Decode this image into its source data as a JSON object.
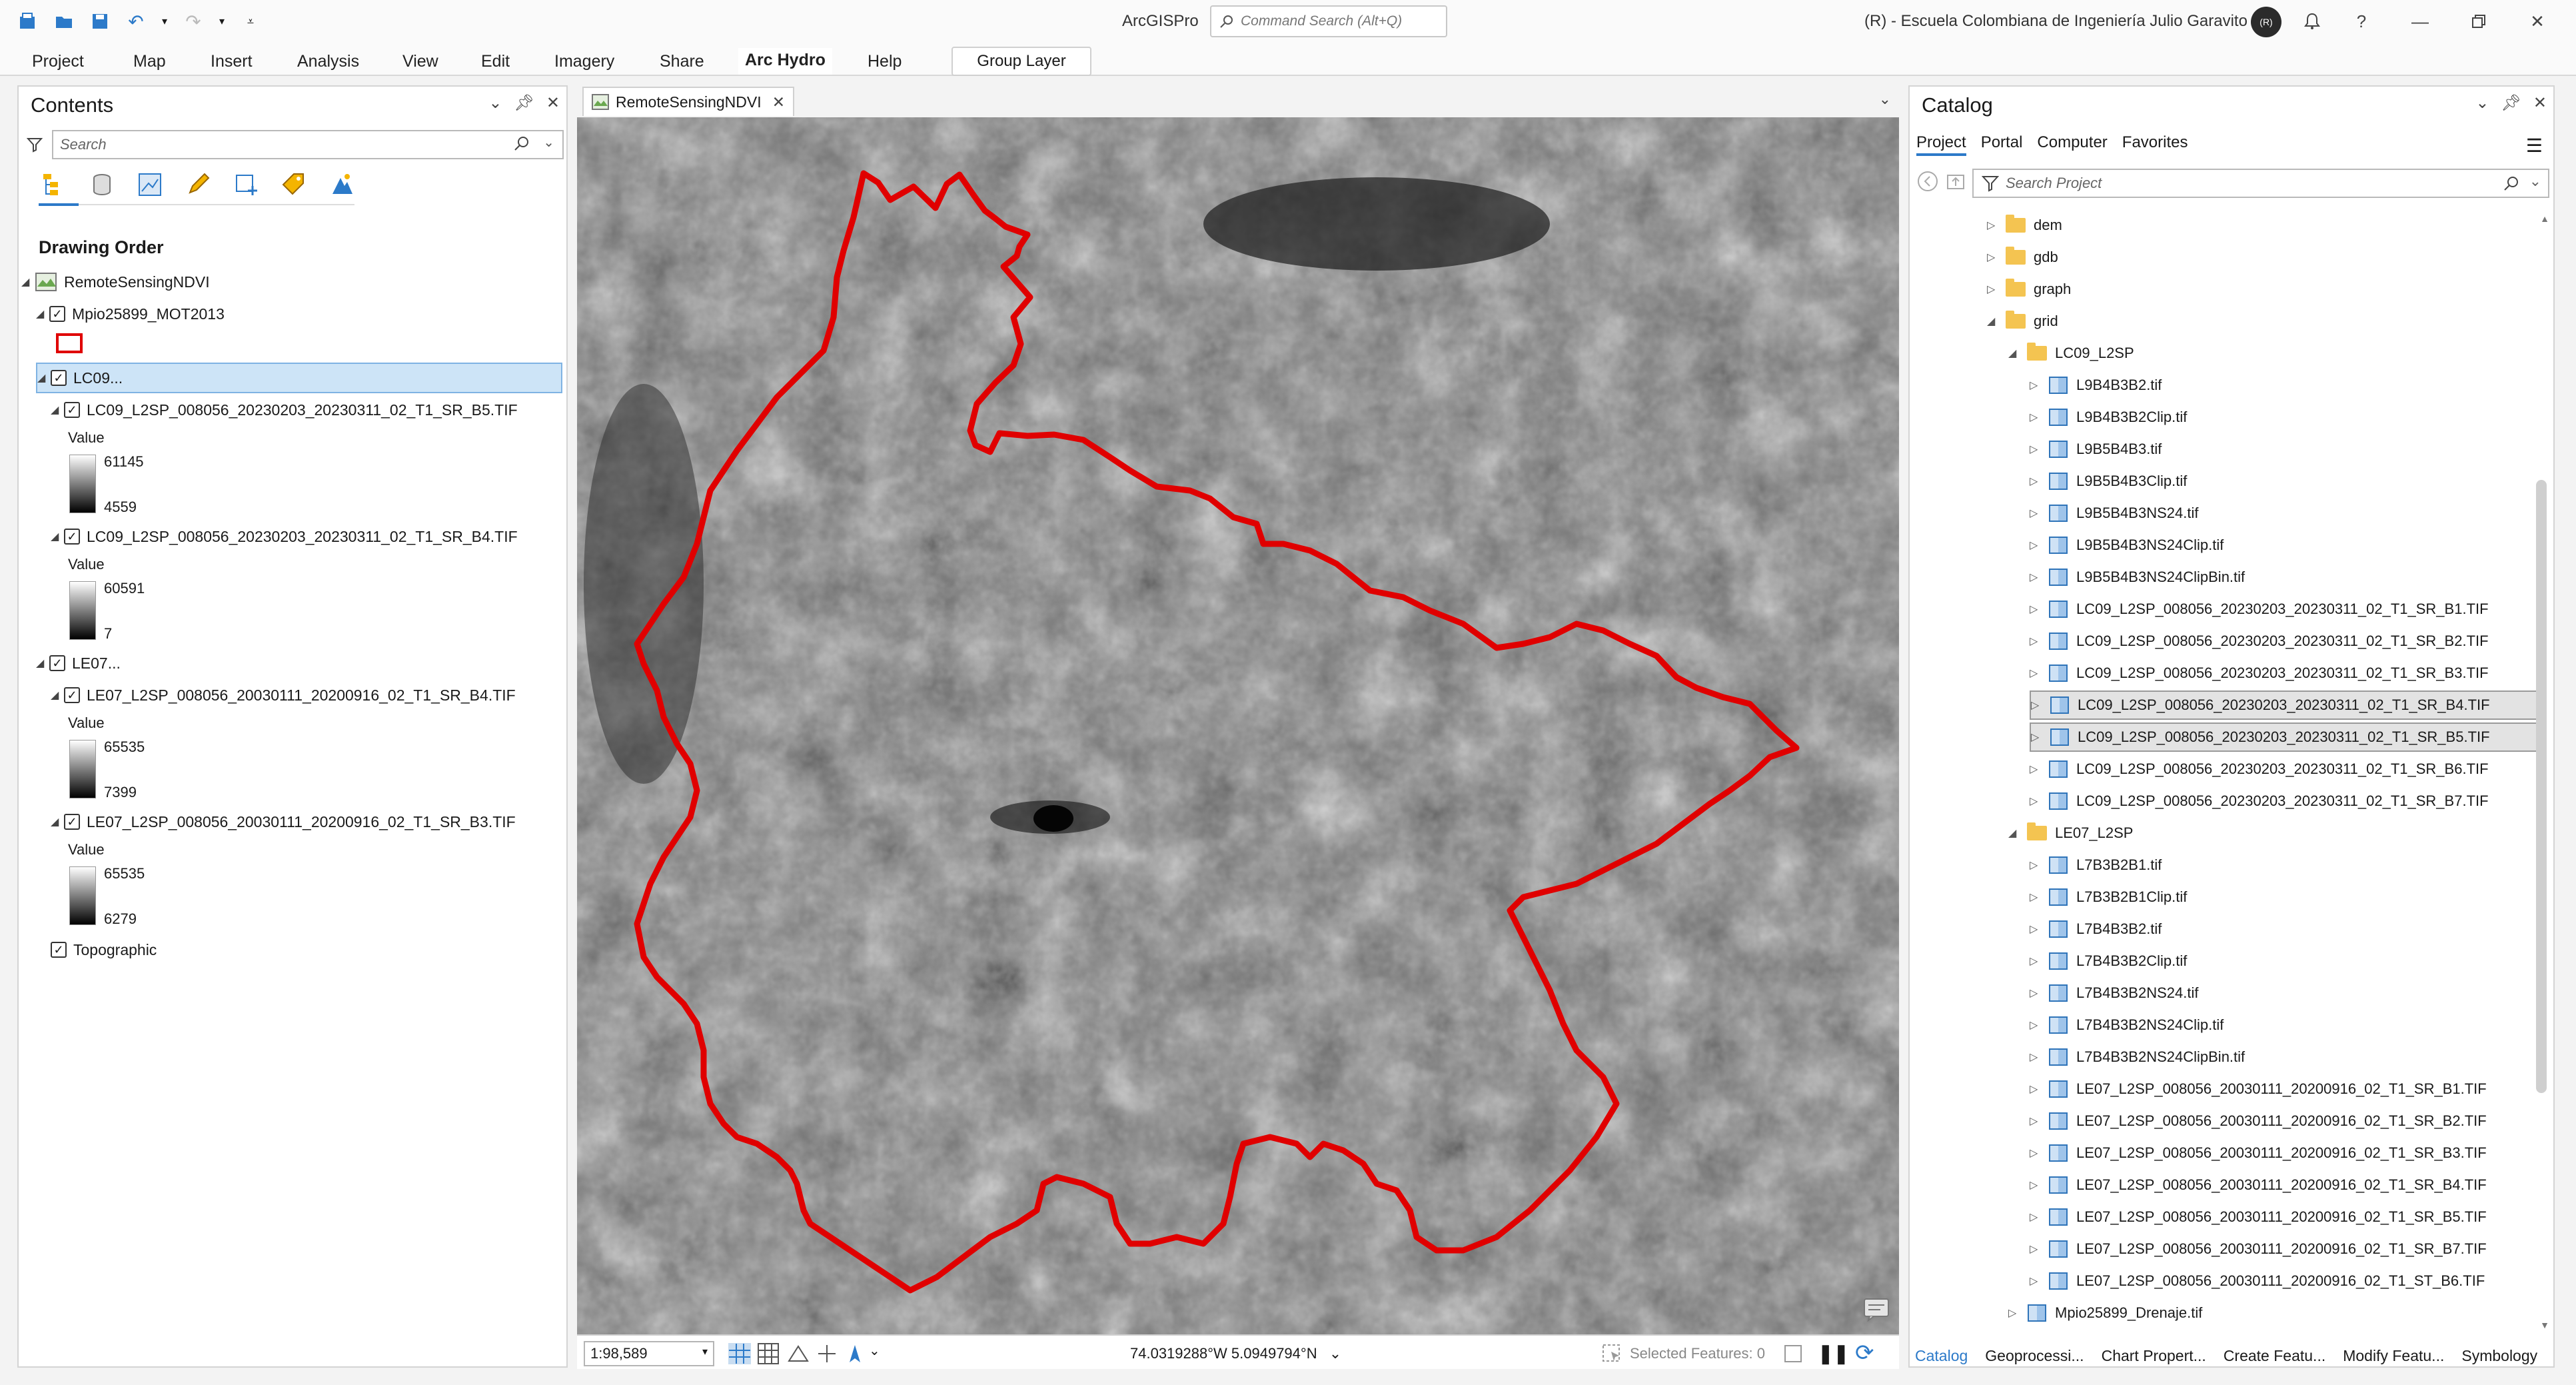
{
  "app": {
    "title": "ArcGISPro",
    "command_search_placeholder": "Command Search (Alt+Q)",
    "org": "(R) - Escuela Colombiana de Ingeniería Julio Garavito",
    "avatar_initials": "(R)"
  },
  "ribbon": {
    "tabs": [
      "Project",
      "Map",
      "Insert",
      "Analysis",
      "View",
      "Edit",
      "Imagery",
      "Share",
      "Arc Hydro",
      "Help"
    ],
    "active_tab": "Arc Hydro",
    "contextual_group": "Group Layer"
  },
  "contents": {
    "title": "Contents",
    "search_placeholder": "Search",
    "drawing_order_label": "Drawing Order",
    "map_name": "RemoteSensingNDVI",
    "layers": {
      "mpio": "Mpio25899_MOT2013",
      "lc09_group": "LC09...",
      "lc09_b5": "LC09_L2SP_008056_20230203_20230311_02_T1_SR_B5.TIF",
      "lc09_b5_value": "Value",
      "lc09_b5_high": "61145",
      "lc09_b5_low": "4559",
      "lc09_b4": "LC09_L2SP_008056_20230203_20230311_02_T1_SR_B4.TIF",
      "lc09_b4_value": "Value",
      "lc09_b4_high": "60591",
      "lc09_b4_low": "7",
      "le07_group": "LE07...",
      "le07_b4": "LE07_L2SP_008056_20030111_20200916_02_T1_SR_B4.TIF",
      "le07_b4_value": "Value",
      "le07_b4_high": "65535",
      "le07_b4_low": "7399",
      "le07_b3": "LE07_L2SP_008056_20030111_20200916_02_T1_SR_B3.TIF",
      "le07_b3_value": "Value",
      "le07_b3_high": "65535",
      "le07_b3_low": "6279",
      "topographic": "Topographic"
    }
  },
  "map": {
    "tab_label": "RemoteSensingNDVI",
    "scale": "1:98,589",
    "coordinates": "74.0319288°W 5.0949794°N",
    "selected_features": "Selected Features: 0",
    "boundary_color": "#e00000"
  },
  "catalog": {
    "title": "Catalog",
    "tabs": [
      "Project",
      "Portal",
      "Computer",
      "Favorites"
    ],
    "active_tab": "Project",
    "search_placeholder": "Search Project",
    "items": {
      "dem": "dem",
      "gdb": "gdb",
      "graph": "graph",
      "grid": "grid",
      "lc09_folder": "LC09_L2SP",
      "l9_1": "L9B4B3B2.tif",
      "l9_2": "L9B4B3B2Clip.tif",
      "l9_3": "L9B5B4B3.tif",
      "l9_4": "L9B5B4B3Clip.tif",
      "l9_5": "L9B5B4B3NS24.tif",
      "l9_6": "L9B5B4B3NS24Clip.tif",
      "l9_7": "L9B5B4B3NS24ClipBin.tif",
      "lc09_b1": "LC09_L2SP_008056_20230203_20230311_02_T1_SR_B1.TIF",
      "lc09_b2": "LC09_L2SP_008056_20230203_20230311_02_T1_SR_B2.TIF",
      "lc09_b3": "LC09_L2SP_008056_20230203_20230311_02_T1_SR_B3.TIF",
      "lc09_b4": "LC09_L2SP_008056_20230203_20230311_02_T1_SR_B4.TIF",
      "lc09_b5": "LC09_L2SP_008056_20230203_20230311_02_T1_SR_B5.TIF",
      "lc09_b6": "LC09_L2SP_008056_20230203_20230311_02_T1_SR_B6.TIF",
      "lc09_b7": "LC09_L2SP_008056_20230203_20230311_02_T1_SR_B7.TIF",
      "le07_folder": "LE07_L2SP",
      "l7_1": "L7B3B2B1.tif",
      "l7_2": "L7B3B2B1Clip.tif",
      "l7_3": "L7B4B3B2.tif",
      "l7_4": "L7B4B3B2Clip.tif",
      "l7_5": "L7B4B3B2NS24.tif",
      "l7_6": "L7B4B3B2NS24Clip.tif",
      "l7_7": "L7B4B3B2NS24ClipBin.tif",
      "le07_b1": "LE07_L2SP_008056_20030111_20200916_02_T1_SR_B1.TIF",
      "le07_b2": "LE07_L2SP_008056_20030111_20200916_02_T1_SR_B2.TIF",
      "le07_b3": "LE07_L2SP_008056_20030111_20200916_02_T1_SR_B3.TIF",
      "le07_b4": "LE07_L2SP_008056_20030111_20200916_02_T1_SR_B4.TIF",
      "le07_b5": "LE07_L2SP_008056_20030111_20200916_02_T1_SR_B5.TIF",
      "le07_b7": "LE07_L2SP_008056_20030111_20200916_02_T1_SR_B7.TIF",
      "le07_b6": "LE07_L2SP_008056_20030111_20200916_02_T1_ST_B6.TIF",
      "drenaje": "Mpio25899_Drenaje.tif"
    }
  },
  "bottom_tabs": [
    "Catalog",
    "Geoprocessi...",
    "Chart Propert...",
    "Create Featu...",
    "Modify Featu...",
    "Symbology"
  ],
  "colors": {
    "accent": "#2c7ac9",
    "selection": "#cde4f7",
    "folder": "#f4c451"
  }
}
